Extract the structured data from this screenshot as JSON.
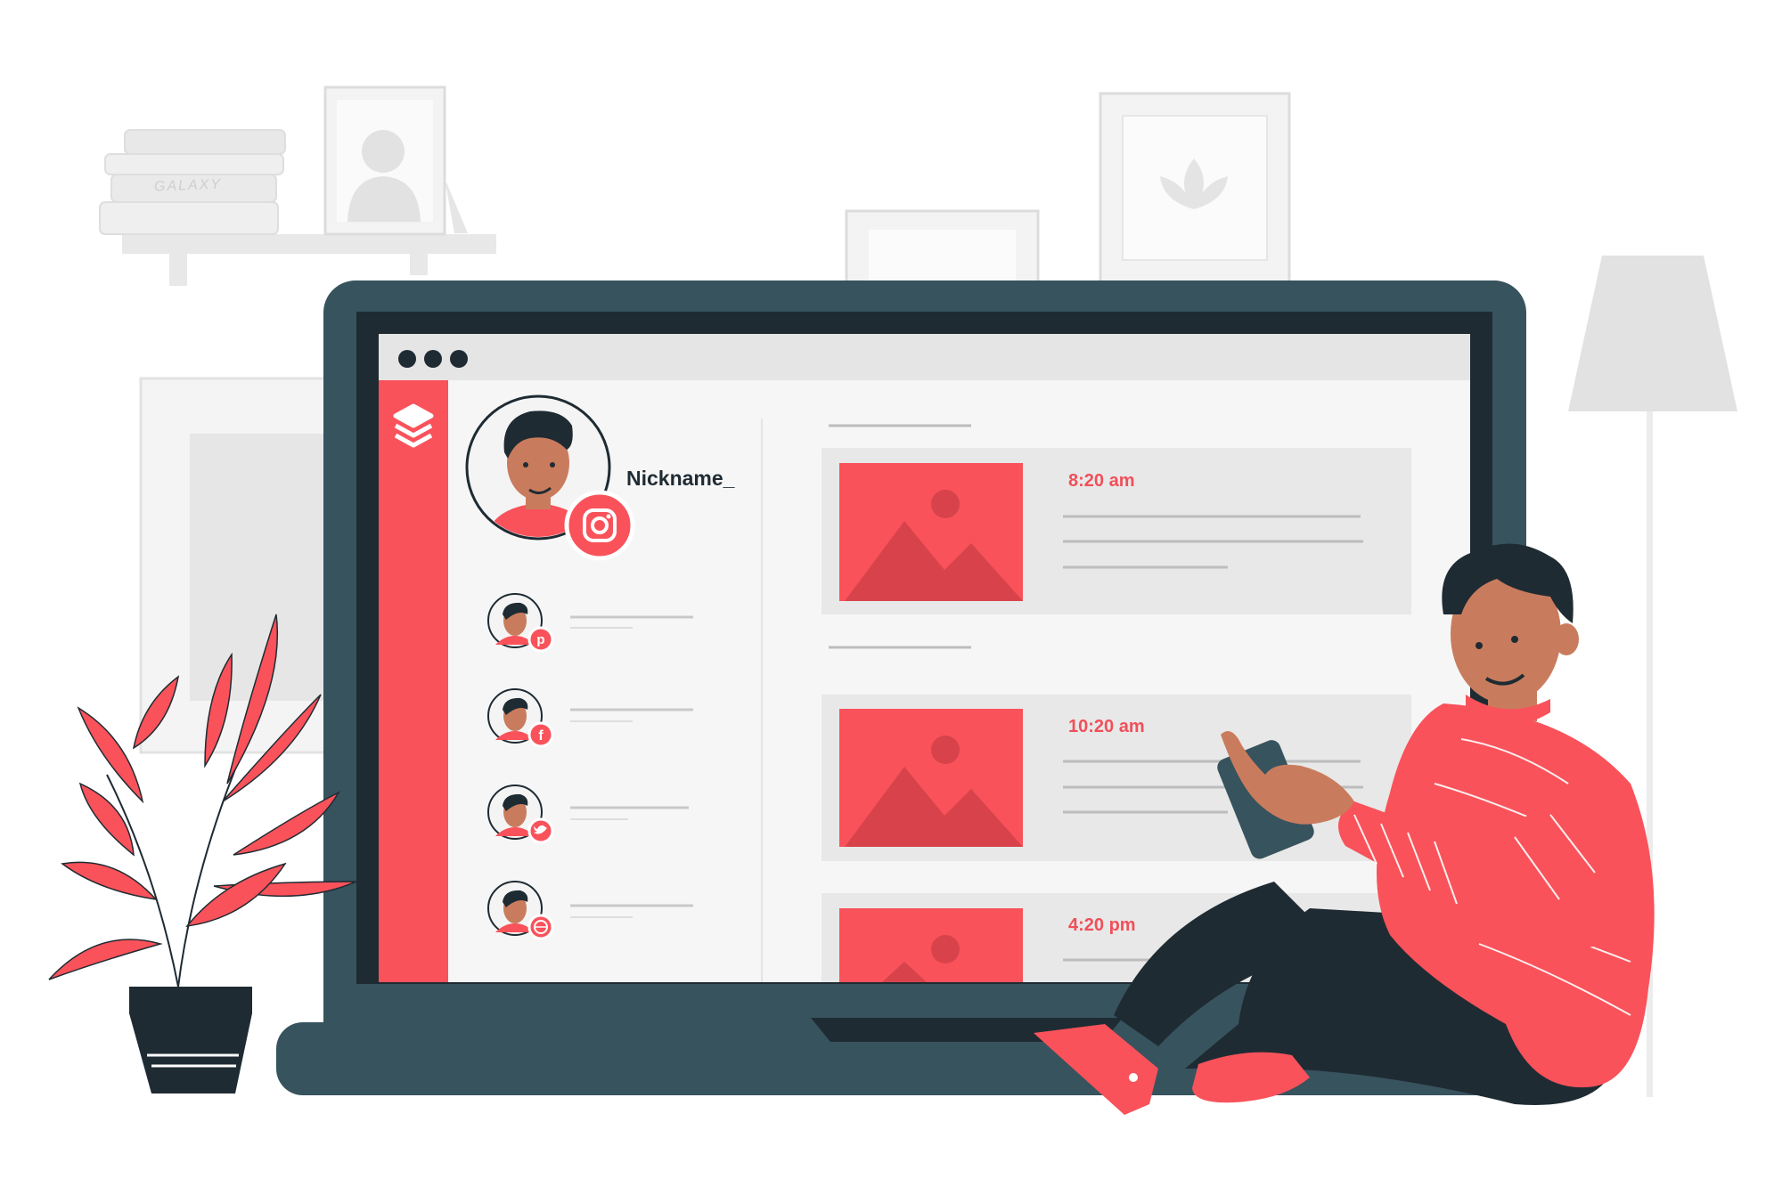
{
  "profile": {
    "nickname": "Nickname_",
    "main_network_icon": "instagram-icon"
  },
  "social_accounts": [
    {
      "network": "pinterest",
      "icon": "pinterest-icon"
    },
    {
      "network": "facebook",
      "icon": "facebook-icon"
    },
    {
      "network": "twitter",
      "icon": "twitter-icon"
    },
    {
      "network": "dribbble",
      "icon": "dribbble-icon"
    }
  ],
  "feed": {
    "posts": [
      {
        "time": "8:20 am"
      },
      {
        "time": "10:20 am"
      },
      {
        "time": "4:20 pm"
      }
    ]
  },
  "decor": {
    "book_spine_label": "GALAXY"
  },
  "colors": {
    "accent": "#f9525a",
    "accent_dark": "#d8434b",
    "laptop": "#37535e",
    "screen_bezel": "#1f2b33",
    "background_decor": "#e6e6e6"
  }
}
